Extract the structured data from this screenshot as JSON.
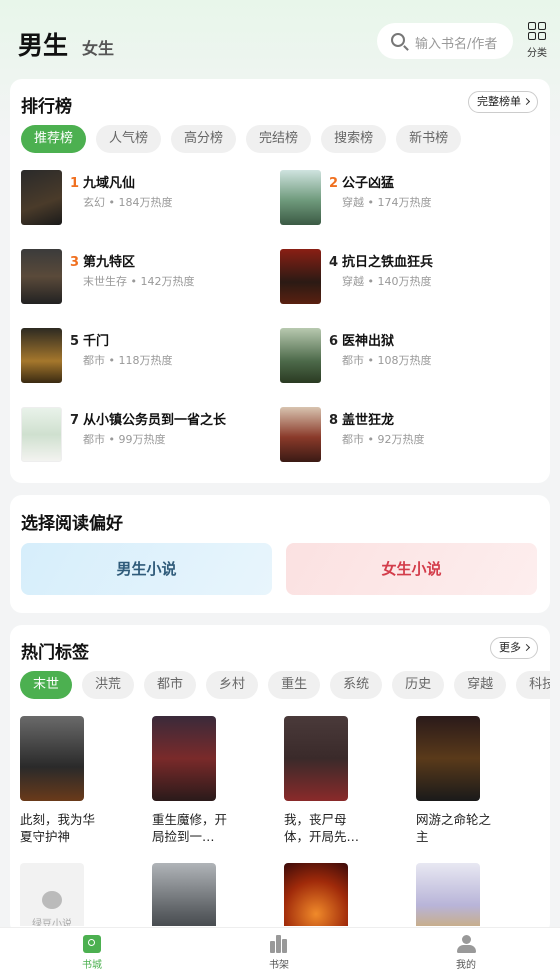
{
  "header": {
    "tab_male": "男生",
    "tab_female": "女生",
    "search_placeholder": "输入书名/作者",
    "category_label": "分类"
  },
  "ranking": {
    "title": "排行榜",
    "full_list_label": "完整榜单",
    "tabs": [
      "推荐榜",
      "人气榜",
      "高分榜",
      "完结榜",
      "搜索榜",
      "新书榜"
    ],
    "active_tab": "推荐榜",
    "items": [
      {
        "rank": "1",
        "title": "九域凡仙",
        "meta": "玄幻 • 184万热度"
      },
      {
        "rank": "2",
        "title": "公子凶猛",
        "meta": "穿越 • 174万热度"
      },
      {
        "rank": "3",
        "title": "第九特区",
        "meta": "末世生存 • 142万热度"
      },
      {
        "rank": "4",
        "title": "抗日之铁血狂兵",
        "meta": "穿越 • 140万热度"
      },
      {
        "rank": "5",
        "title": "千门",
        "meta": "都市 • 118万热度"
      },
      {
        "rank": "6",
        "title": "医神出狱",
        "meta": "都市 • 108万热度"
      },
      {
        "rank": "7",
        "title": "从小镇公务员到一省之长",
        "meta": "都市 • 99万热度"
      },
      {
        "rank": "8",
        "title": "盖世狂龙",
        "meta": "都市 • 92万热度"
      }
    ]
  },
  "preference": {
    "title": "选择阅读偏好",
    "male_label": "男生小说",
    "female_label": "女生小说"
  },
  "hot_tags": {
    "title": "热门标签",
    "more_label": "更多",
    "tags": [
      "末世",
      "洪荒",
      "都市",
      "乡村",
      "重生",
      "系统",
      "历史",
      "穿越",
      "科技"
    ],
    "active_tag": "末世",
    "books": [
      {
        "title": "此刻，我为华夏守护神"
      },
      {
        "title": "重生魔修，开局捡到一…"
      },
      {
        "title": "我，丧尸母体，开局先…"
      },
      {
        "title": "网游之命轮之主"
      },
      {
        "title": "",
        "placeholder_text": "绿豆小说"
      },
      {
        "title": ""
      },
      {
        "title": ""
      },
      {
        "title": ""
      }
    ]
  },
  "bottom_nav": {
    "items": [
      {
        "label": "书城",
        "active": true
      },
      {
        "label": "书架",
        "active": false
      },
      {
        "label": "我的",
        "active": false
      }
    ]
  },
  "colors": {
    "accent": "#4cb050",
    "rank_hot": "#f07020",
    "female_text": "#d33c4a",
    "male_text": "#2f5b7a"
  }
}
